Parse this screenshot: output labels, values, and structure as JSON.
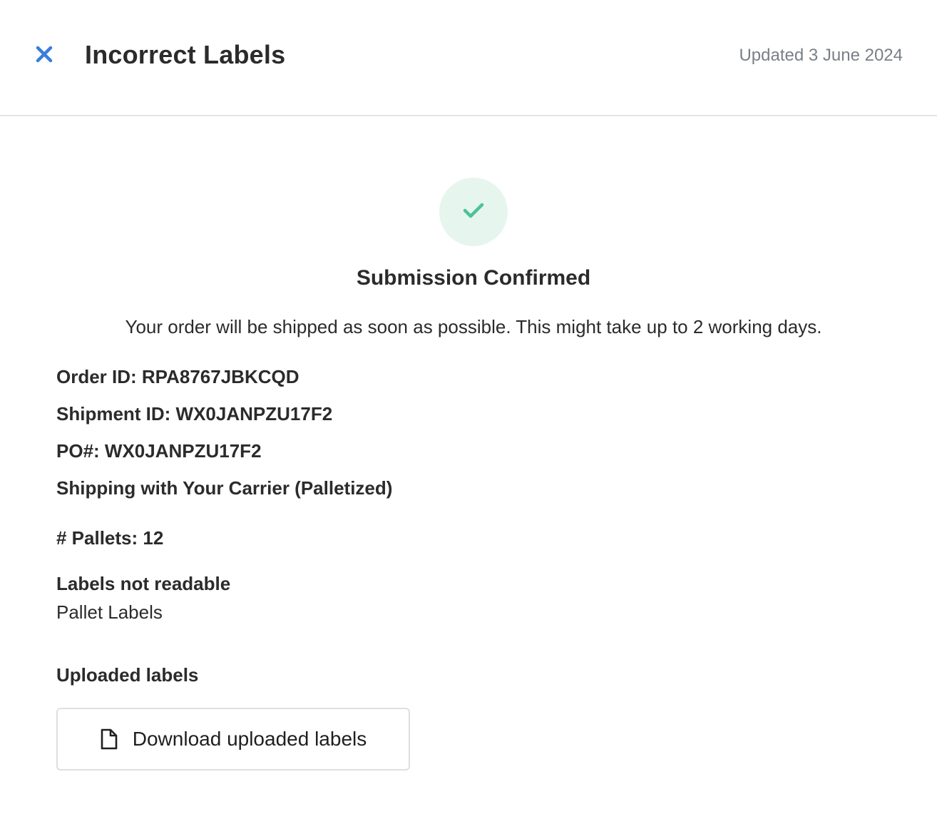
{
  "header": {
    "title": "Incorrect Labels",
    "updated": "Updated 3 June 2024",
    "close_icon": "close-icon",
    "accent_color": "#3b7ddd"
  },
  "confirmation": {
    "icon": "check-icon",
    "icon_color": "#4cc29a",
    "icon_bg": "#e6f6ef",
    "title": "Submission Confirmed",
    "message": "Your order will be shipped as soon as possible. This might take up to 2 working days."
  },
  "details": {
    "order_id": "Order ID: RPA8767JBKCQD",
    "shipment_id": "Shipment ID: WX0JANPZU17F2",
    "po_number": "PO#: WX0JANPZU17F2",
    "shipping_method": "Shipping with Your Carrier (Palletized)",
    "pallets": "# Pallets: 12",
    "issue_heading": "Labels not readable",
    "issue_value": "Pallet Labels",
    "uploaded_heading": "Uploaded labels"
  },
  "download": {
    "label": "Download uploaded labels",
    "icon": "file-icon"
  }
}
